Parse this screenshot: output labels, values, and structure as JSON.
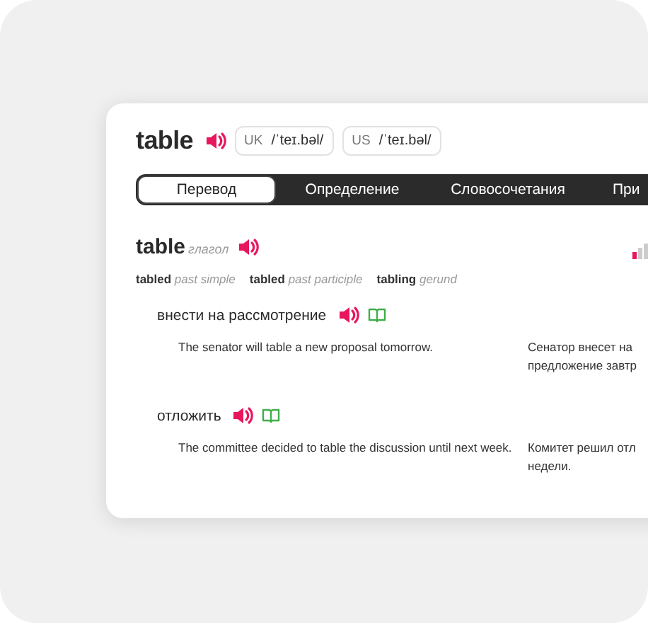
{
  "header": {
    "word": "table",
    "pronunciations": [
      {
        "region": "UK",
        "ipa": "/ˈteɪ.bəl/"
      },
      {
        "region": "US",
        "ipa": "/ˈteɪ.bəl/"
      }
    ]
  },
  "tabs": [
    {
      "label": "Перевод",
      "selected": true
    },
    {
      "label": "Определение",
      "selected": false
    },
    {
      "label": "Словосочетания",
      "selected": false
    },
    {
      "label": "При",
      "selected": false
    }
  ],
  "entry": {
    "word": "table",
    "part_of_speech": "глагол",
    "forms": [
      {
        "form": "tabled",
        "label": "past simple"
      },
      {
        "form": "tabled",
        "label": "past participle"
      },
      {
        "form": "tabling",
        "label": "gerund"
      }
    ],
    "senses": [
      {
        "translation": "внести на рассмотрение",
        "examples": [
          {
            "en": "The senator will table a new proposal tomorrow.",
            "ru": "Сенатор внесет на\nпредложение завтр"
          }
        ]
      },
      {
        "translation": "отложить",
        "examples": [
          {
            "en": "The committee decided to table the discussion until next week.",
            "ru": "Комитет решил отл\nнедели."
          }
        ]
      }
    ]
  }
}
